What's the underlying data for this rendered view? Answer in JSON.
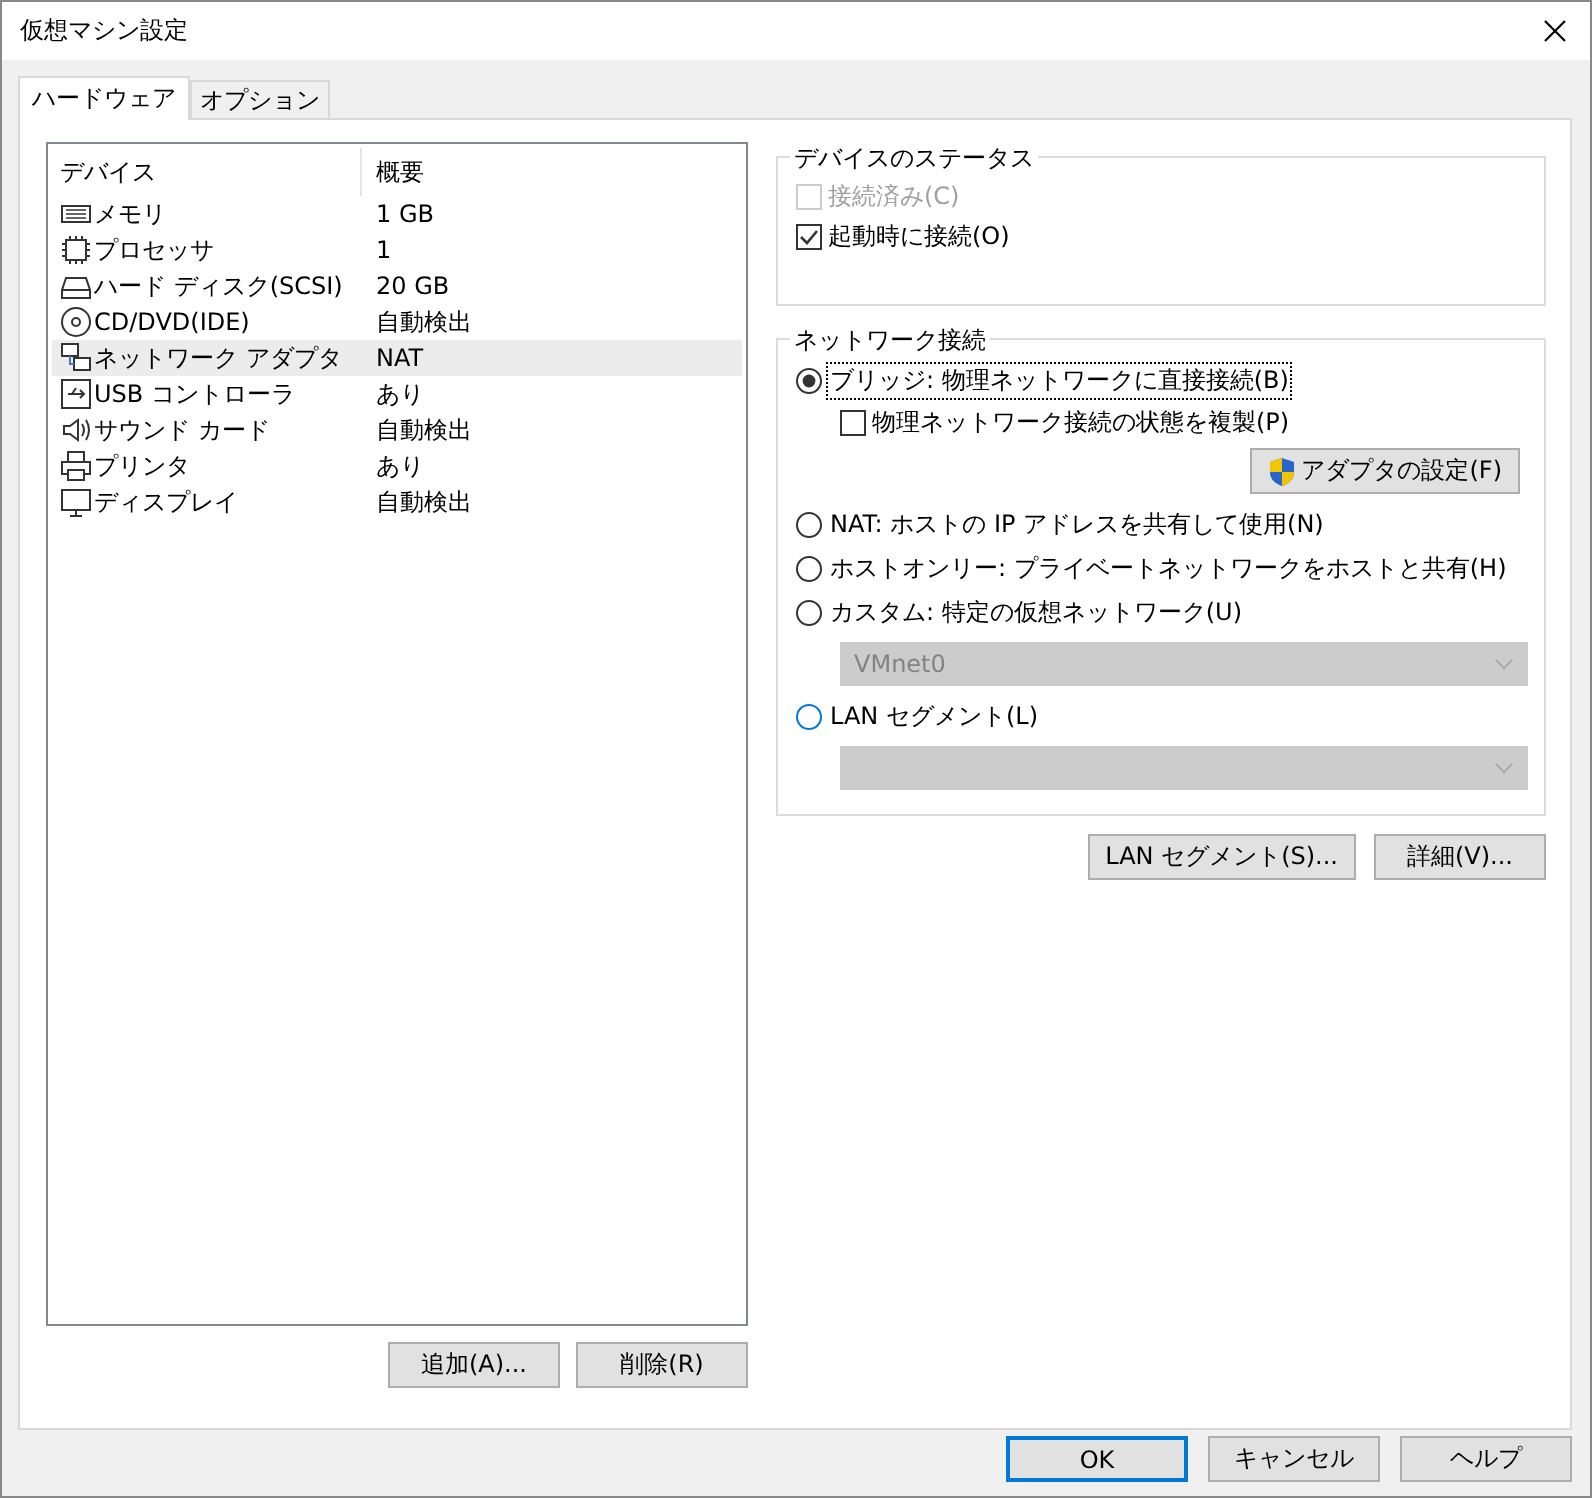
{
  "window": {
    "title": "仮想マシン設定"
  },
  "tabs": [
    {
      "label": "ハードウェア",
      "selected": true
    },
    {
      "label": "オプション",
      "selected": false
    }
  ],
  "device_list": {
    "columns": [
      "デバイス",
      "概要"
    ],
    "rows": [
      {
        "kind": "memory",
        "device": "メモリ",
        "summary": "1 GB",
        "selected": false
      },
      {
        "kind": "processor",
        "device": "プロセッサ",
        "summary": "1",
        "selected": false
      },
      {
        "kind": "disk",
        "device": "ハード ディスク(SCSI)",
        "summary": "20 GB",
        "selected": false
      },
      {
        "kind": "cd",
        "device": "CD/DVD(IDE)",
        "summary": "自動検出",
        "selected": false
      },
      {
        "kind": "network",
        "device": "ネットワーク アダプタ",
        "summary": "NAT",
        "selected": true
      },
      {
        "kind": "usb",
        "device": "USB コントローラ",
        "summary": "あり",
        "selected": false
      },
      {
        "kind": "sound",
        "device": "サウンド カード",
        "summary": "自動検出",
        "selected": false
      },
      {
        "kind": "printer",
        "device": "プリンタ",
        "summary": "あり",
        "selected": false
      },
      {
        "kind": "display",
        "device": "ディスプレイ",
        "summary": "自動検出",
        "selected": false
      }
    ]
  },
  "list_buttons": [
    "追加(A)...",
    "削除(R)"
  ],
  "device_status": {
    "title": "デバイスのステータス",
    "options": [
      {
        "label": "接続済み(C)",
        "checked": false,
        "disabled": true
      },
      {
        "label": "起動時に接続(O)",
        "checked": true,
        "disabled": false
      }
    ]
  },
  "network": {
    "title": "ネットワーク接続",
    "options": [
      {
        "kind": "radio",
        "label": "ブリッジ: 物理ネットワークに直接接続(B)",
        "selected": true,
        "focused": true,
        "hovered": false
      },
      {
        "kind": "checkbox",
        "label": "物理ネットワーク接続の状態を複製(P)",
        "checked": false
      },
      {
        "kind": "button",
        "label": "アダプタの設定(F)"
      },
      {
        "kind": "radio",
        "label": "NAT: ホストの IP アドレスを共有して使用(N)",
        "selected": false,
        "focused": false,
        "hovered": false
      },
      {
        "kind": "radio",
        "label": "ホストオンリー: プライベートネットワークをホストと共有(H)",
        "selected": false,
        "focused": false,
        "hovered": false
      },
      {
        "kind": "radio",
        "label": "カスタム: 特定の仮想ネットワーク(U)",
        "selected": false,
        "focused": false,
        "hovered": false
      },
      {
        "kind": "dropdown",
        "value": "VMnet0",
        "disabled": true
      },
      {
        "kind": "radio",
        "label": "LAN セグメント(L)",
        "selected": false,
        "focused": false,
        "hovered": true
      },
      {
        "kind": "dropdown",
        "disabled": true
      }
    ]
  },
  "network_buttons": [
    "LAN セグメント(S)...",
    "詳細(V)..."
  ],
  "dialog_buttons": [
    {
      "label": "OK",
      "default": true
    },
    {
      "label": "キャンセル",
      "default": false
    },
    {
      "label": "ヘルプ",
      "default": false
    }
  ]
}
